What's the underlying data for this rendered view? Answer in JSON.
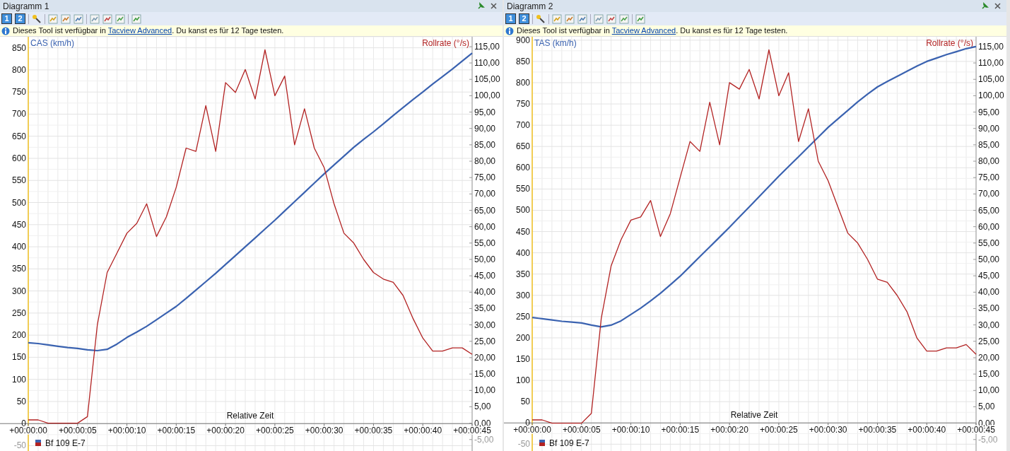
{
  "panels": [
    {
      "title": "Diagramm 1",
      "toolbar": {
        "view_buttons": [
          "1",
          "2"
        ]
      },
      "info": {
        "text": "Dieses Tool ist verfügbar in ",
        "link": "Tacview Advanced",
        "text_after": ". Du kanst es für 12 Tage testen."
      },
      "chart_data": {
        "type": "line",
        "grid": true,
        "xlabel": "Relative Zeit",
        "ylim": [
          -62,
          875
        ],
        "y2lim": [
          -8.5,
          118
        ],
        "yticks": [
          -50,
          0,
          50,
          100,
          150,
          200,
          250,
          300,
          350,
          400,
          450,
          500,
          550,
          600,
          650,
          700,
          750,
          800,
          850
        ],
        "y2ticks": [
          {
            "value": -5,
            "label": "-5,00"
          },
          {
            "value": 0,
            "label": "0,00"
          },
          {
            "value": 5,
            "label": "5,00"
          },
          {
            "value": 10,
            "label": "10,00"
          },
          {
            "value": 15,
            "label": "15,00"
          },
          {
            "value": 20,
            "label": "20,00"
          },
          {
            "value": 25,
            "label": "25,00"
          },
          {
            "value": 30,
            "label": "30,00"
          },
          {
            "value": 35,
            "label": "35,00"
          },
          {
            "value": 40,
            "label": "40,00"
          },
          {
            "value": 45,
            "label": "45,00"
          },
          {
            "value": 50,
            "label": "50,00"
          },
          {
            "value": 55,
            "label": "55,00"
          },
          {
            "value": 60,
            "label": "60,00"
          },
          {
            "value": 65,
            "label": "65,00"
          },
          {
            "value": 70,
            "label": "70,00"
          },
          {
            "value": 75,
            "label": "75,00"
          },
          {
            "value": 80,
            "label": "80,00"
          },
          {
            "value": 85,
            "label": "85,00"
          },
          {
            "value": 90,
            "label": "90,00"
          },
          {
            "value": 95,
            "label": "95,00"
          },
          {
            "value": 100,
            "label": "100,00"
          },
          {
            "value": 105,
            "label": "105,00"
          },
          {
            "value": 110,
            "label": "110,00"
          },
          {
            "value": 115,
            "label": "115,00"
          }
        ],
        "categories": [
          "+00:00:00",
          null,
          null,
          null,
          null,
          "+00:00:05",
          null,
          null,
          null,
          null,
          "+00:00:10",
          null,
          null,
          null,
          null,
          "+00:00:15",
          null,
          null,
          null,
          null,
          "+00:00:20",
          null,
          null,
          null,
          null,
          "+00:00:25",
          null,
          null,
          null,
          null,
          "+00:00:30",
          null,
          null,
          null,
          null,
          "+00:00:35",
          null,
          null,
          null,
          null,
          "+00:00:40",
          null,
          null,
          null,
          null,
          "+00:00:45"
        ],
        "series": [
          {
            "name": "CAS (km/h)",
            "color": "#3a62b0",
            "values": [
              183,
              181,
              178,
              175,
              172,
              170,
              167,
              165,
              168,
              180,
              195,
              207,
              220,
              235,
              250,
              265,
              283,
              302,
              321,
              340,
              360,
              380,
              400,
              420,
              440,
              460,
              481,
              502,
              523,
              544,
              565,
              585,
              605,
              625,
              643,
              660,
              678,
              697,
              715,
              733,
              750,
              768,
              785,
              802,
              820,
              838
            ]
          },
          {
            "name": "Rollrate (°/s)",
            "axis": "y2",
            "color": "#b22222",
            "values": [
              1,
              1,
              0,
              0,
              0,
              0,
              2,
              30,
              46,
              52,
              58,
              61,
              67,
              57,
              63,
              72,
              84,
              83,
              97,
              83,
              104,
              101,
              108,
              99,
              114,
              100,
              106,
              85,
              96,
              84,
              78,
              67,
              58,
              55,
              50,
              46,
              44,
              43,
              39,
              32,
              26,
              22,
              22,
              23,
              23,
              21
            ]
          }
        ]
      },
      "legend": {
        "label": "Bf 109 E-7"
      }
    },
    {
      "title": "Diagramm 2",
      "toolbar": {
        "view_buttons": [
          "1",
          "2"
        ]
      },
      "info": {
        "text": "Dieses Tool ist verfügbar in ",
        "link": "Tacview Advanced",
        "text_after": ". Du kanst es für 12 Tage testen."
      },
      "chart_data": {
        "type": "line",
        "grid": true,
        "xlabel": "Relative Zeit",
        "ylim": [
          -66,
          908
        ],
        "y2lim": [
          -8.5,
          118
        ],
        "yticks": [
          -50,
          0,
          50,
          100,
          150,
          200,
          250,
          300,
          350,
          400,
          450,
          500,
          550,
          600,
          650,
          700,
          750,
          800,
          850,
          900
        ],
        "y2ticks": [
          {
            "value": -5,
            "label": "-5,00"
          },
          {
            "value": 0,
            "label": "0,00"
          },
          {
            "value": 5,
            "label": "5,00"
          },
          {
            "value": 10,
            "label": "10,00"
          },
          {
            "value": 15,
            "label": "15,00"
          },
          {
            "value": 20,
            "label": "20,00"
          },
          {
            "value": 25,
            "label": "25,00"
          },
          {
            "value": 30,
            "label": "30,00"
          },
          {
            "value": 35,
            "label": "35,00"
          },
          {
            "value": 40,
            "label": "40,00"
          },
          {
            "value": 45,
            "label": "45,00"
          },
          {
            "value": 50,
            "label": "50,00"
          },
          {
            "value": 55,
            "label": "55,00"
          },
          {
            "value": 60,
            "label": "60,00"
          },
          {
            "value": 65,
            "label": "65,00"
          },
          {
            "value": 70,
            "label": "70,00"
          },
          {
            "value": 75,
            "label": "75,00"
          },
          {
            "value": 80,
            "label": "80,00"
          },
          {
            "value": 85,
            "label": "85,00"
          },
          {
            "value": 90,
            "label": "90,00"
          },
          {
            "value": 95,
            "label": "95,00"
          },
          {
            "value": 100,
            "label": "100,00"
          },
          {
            "value": 105,
            "label": "105,00"
          },
          {
            "value": 110,
            "label": "110,00"
          },
          {
            "value": 115,
            "label": "115,00"
          }
        ],
        "categories": [
          "+00:00:00",
          null,
          null,
          null,
          null,
          "+00:00:05",
          null,
          null,
          null,
          null,
          "+00:00:10",
          null,
          null,
          null,
          null,
          "+00:00:15",
          null,
          null,
          null,
          null,
          "+00:00:20",
          null,
          null,
          null,
          null,
          "+00:00:25",
          null,
          null,
          null,
          null,
          "+00:00:30",
          null,
          null,
          null,
          null,
          "+00:00:35",
          null,
          null,
          null,
          null,
          "+00:00:40",
          null,
          null,
          null,
          null,
          "+00:00:45"
        ],
        "series": [
          {
            "name": "TAS (km/h)",
            "color": "#3a62b0",
            "values": [
              248,
              245,
              242,
              239,
              237,
              235,
              230,
              226,
              230,
              240,
              255,
              270,
              287,
              305,
              325,
              345,
              368,
              391,
              414,
              437,
              460,
              484,
              508,
              532,
              556,
              580,
              603,
              626,
              649,
              672,
              695,
              715,
              735,
              755,
              773,
              790,
              803,
              815,
              827,
              839,
              850,
              858,
              866,
              873,
              880,
              885
            ]
          },
          {
            "name": "Rollrate (°/s)",
            "axis": "y2",
            "color": "#b22222",
            "values": [
              1,
              1,
              0,
              0,
              0,
              0,
              3,
              32,
              48,
              56,
              62,
              63,
              68,
              57,
              64,
              75,
              86,
              83,
              98,
              85,
              104,
              102,
              108,
              99,
              114,
              100,
              107,
              86,
              96,
              80,
              74,
              66,
              58,
              55,
              50,
              44,
              43,
              39,
              34,
              26,
              22,
              22,
              23,
              23,
              24,
              21
            ]
          }
        ]
      },
      "legend": {
        "label": "Bf 109 E-7"
      }
    }
  ]
}
